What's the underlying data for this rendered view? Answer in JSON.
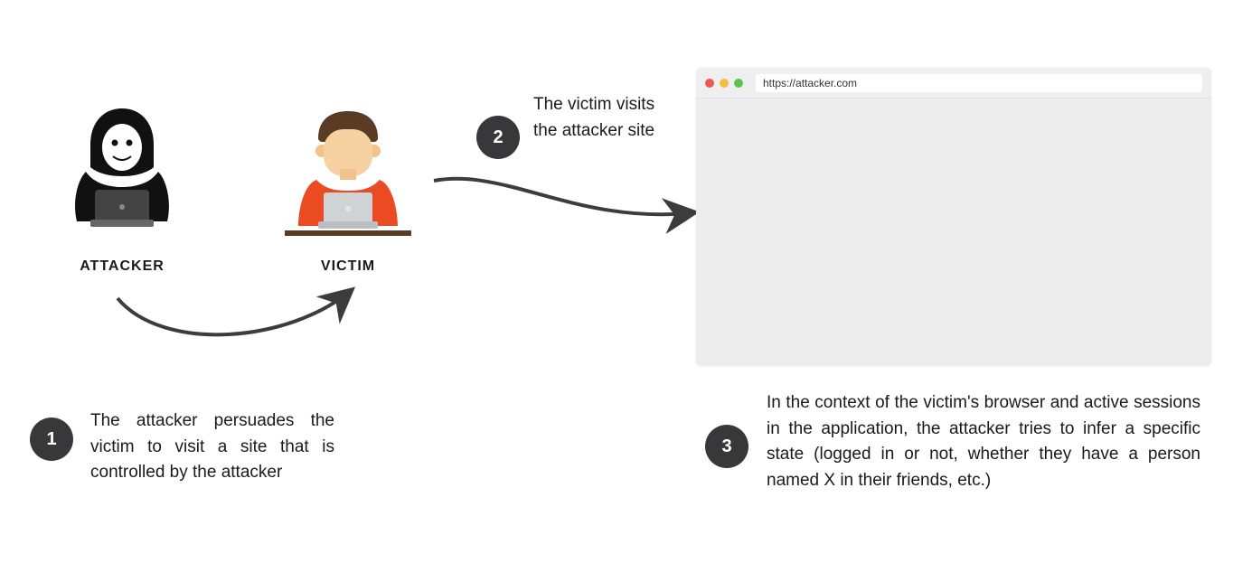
{
  "actors": {
    "attacker_label": "ATTACKER",
    "victim_label": "VICTIM"
  },
  "steps": {
    "one": {
      "num": "1",
      "text": "The attacker persuades the victim to visit a site that is controlled by the attacker"
    },
    "two": {
      "num": "2",
      "text": "The victim visits the attacker site"
    },
    "three": {
      "num": "3",
      "text": "In the context of the victim's browser and active sessions in the application, the attacker tries to infer a specific state (logged in or not, whether they have a person named X in their friends, etc.)"
    }
  },
  "browser": {
    "url": "https://attacker.com"
  }
}
